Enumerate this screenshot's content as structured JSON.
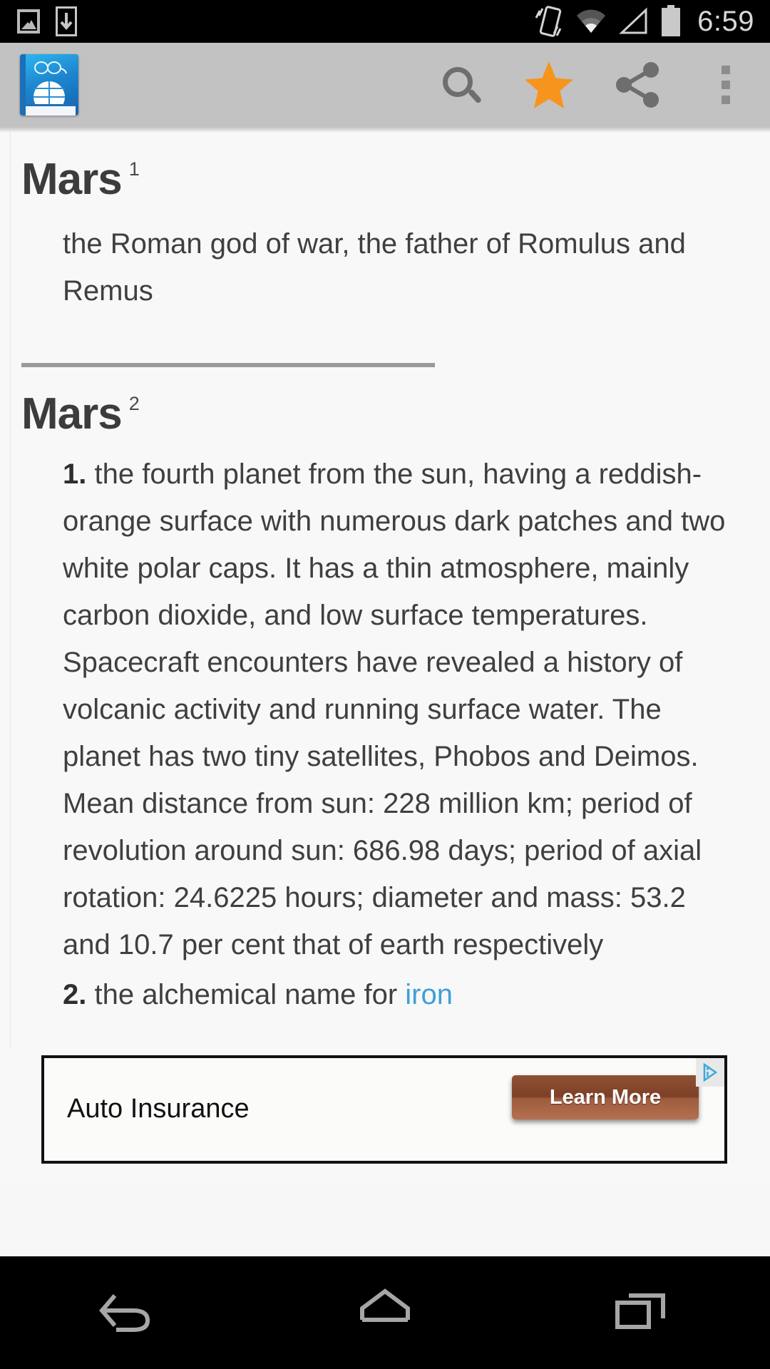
{
  "status_bar": {
    "time": "6:59",
    "icons": [
      "screenshot-icon",
      "download-icon",
      "vibrate-icon",
      "wifi-icon",
      "cell-signal-icon",
      "battery-icon"
    ]
  },
  "app_bar": {
    "logo": "dictionary-book-globe-icon",
    "actions": [
      {
        "name": "search",
        "icon": "search-icon",
        "label": "Search"
      },
      {
        "name": "favorite",
        "icon": "star-icon",
        "label": "Favorite",
        "active": true,
        "color": "#f7941d"
      },
      {
        "name": "share",
        "icon": "share-icon",
        "label": "Share"
      },
      {
        "name": "overflow",
        "icon": "overflow-menu-icon",
        "label": "More options"
      }
    ]
  },
  "entries": [
    {
      "headword": "Mars",
      "superscript": "1",
      "definition": "the Roman god of war, the father of Romulus and Remus"
    },
    {
      "headword": "Mars",
      "superscript": "2",
      "senses": [
        {
          "number": "1.",
          "text": "the fourth planet from the sun, having a reddish-orange surface with numerous dark patches and two white polar caps. It has a thin atmosphere, mainly carbon dioxide, and low surface temperatures. Spacecraft encounters have revealed a history of volcanic activity and running surface water. The planet has two tiny satellites, Phobos and Deimos. Mean distance from sun: 228 million km; period of revolution around sun: 686.98 days; period of axial rotation: 24.6225 hours; diameter and mass: 53.2 and 10.7 per cent that of earth respectively"
        },
        {
          "number": "2.",
          "text_before_link": "the alchemical name for ",
          "link_text": "iron"
        }
      ]
    }
  ],
  "ad": {
    "headline": "Auto Insurance",
    "cta_label": "Learn More",
    "adchoices_icon": "adchoices-icon"
  },
  "nav_bar": {
    "buttons": [
      {
        "name": "back",
        "icon": "back-icon",
        "label": "Back"
      },
      {
        "name": "home",
        "icon": "home-icon",
        "label": "Home"
      },
      {
        "name": "recents",
        "icon": "recents-icon",
        "label": "Recent apps"
      }
    ]
  },
  "colors": {
    "accent": "#f7941d",
    "link": "#3f9fd8",
    "appbar": "#c2c2c2",
    "page_bg": "#f8f8f8"
  }
}
